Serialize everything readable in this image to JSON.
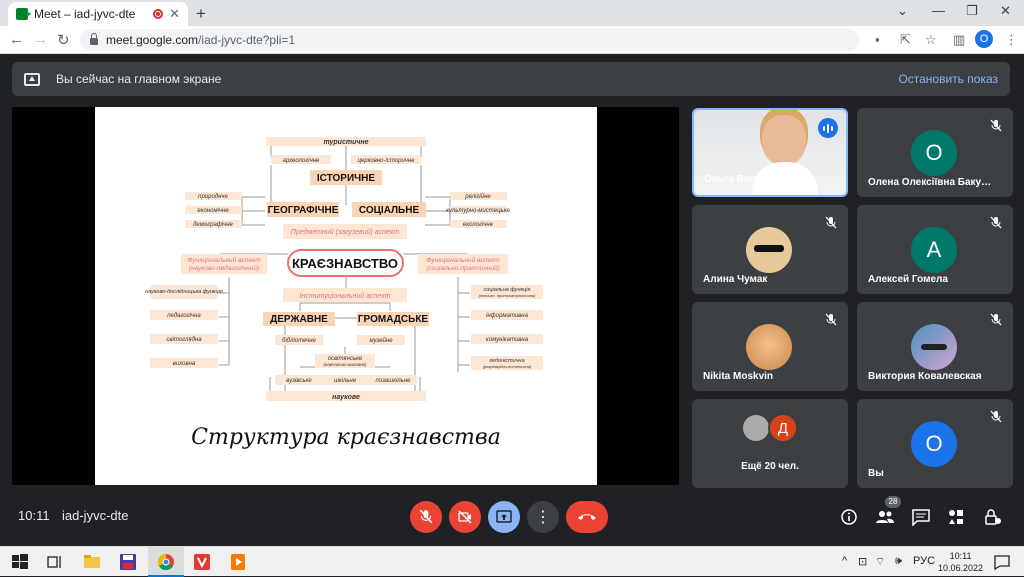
{
  "browser": {
    "tab_title": "Meet – iad-jyvc-dte",
    "url_host": "meet.google.com",
    "url_path": "/iad-jyvc-dte?pli=1",
    "profile_initial": "О"
  },
  "presenting_bar": {
    "message": "Вы сейчас на главном экране",
    "stop_label": "Остановить показ"
  },
  "slide": {
    "top_box": "туристичне",
    "bottom_box": "наукове",
    "historical": "ІСТОРИЧНЕ",
    "geographic": "ГЕОГРАФІЧНЕ",
    "social": "СОЦІАЛЬНЕ",
    "archaeological": "археологічне",
    "church_historical": "церковно-історичне",
    "natural": "природнче",
    "economic": "економічне",
    "demographic": "демографічне",
    "religious": "релігійне",
    "cultural_artistic": "культурно-мистецьке",
    "ecological": "екологічне",
    "subject_aspect": "Предметний (загузевий) аспект",
    "center": "КРАЄЗНАВСТВО",
    "func_left_1": "Функціональний аспект",
    "func_left_2": "(науково-педагогічний)",
    "func_right_1": "Функціональний аспект",
    "func_right_2": "(соціально-практичний)",
    "institutional": "Інституціональний аспект",
    "state": "ДЕРЖАВНЕ",
    "public": "ГРОМАДСЬКЕ",
    "research": "науково-дослідницька функція",
    "pedagogical": "педагогічна",
    "worldview": "світоглядна",
    "upbringing": "виховна",
    "social_function": "соціальна функція",
    "social_function_sub": "(вітчизн. протопатріотична)",
    "informative": "інформативна",
    "communicative": "комунікативна",
    "hedonic": "гедоністична",
    "hedonic_sub": "(рекреаційно-естетична)",
    "libraries": "бібліотечне",
    "museum": "музейне",
    "educational": "освітянське",
    "educational_sub": "(навчально-виховне)",
    "university": "вузівське",
    "school": "шкільне",
    "extracurricular": "позашкільне",
    "caption": "Структура краєзнавства"
  },
  "participants": [
    {
      "name": "Ольга Вовк",
      "type": "video",
      "speaking": true
    },
    {
      "name": "Олена Олексіївна Баку…",
      "initial": "О",
      "color": "#00796b",
      "muted": true
    },
    {
      "name": "Алина Чумак",
      "type": "image",
      "muted": true
    },
    {
      "name": "Алексей Гомела",
      "initial": "А",
      "color": "#00796b",
      "muted": true
    },
    {
      "name": "Nikita Moskvin",
      "type": "image",
      "muted": true
    },
    {
      "name": "Виктория Ковалевская",
      "type": "image",
      "muted": true
    },
    {
      "name": "Ещё 20 чел.",
      "type": "more",
      "extra_initial": "Д"
    },
    {
      "name": "Вы",
      "initial": "О",
      "color": "#1a73e8",
      "muted": true
    }
  ],
  "bottom_bar": {
    "time": "10:11",
    "meeting_code": "iad-jyvc-dte",
    "participants_count": "28"
  },
  "taskbar": {
    "lang": "РУС",
    "time": "10:11",
    "date": "10.06.2022"
  },
  "colors": {
    "meet_bg": "#202124",
    "tile_bg": "#3c4043",
    "danger": "#ea4335",
    "accent": "#8ab4f8",
    "peach": "#f9dcc4",
    "salmon": "#f4a582"
  }
}
